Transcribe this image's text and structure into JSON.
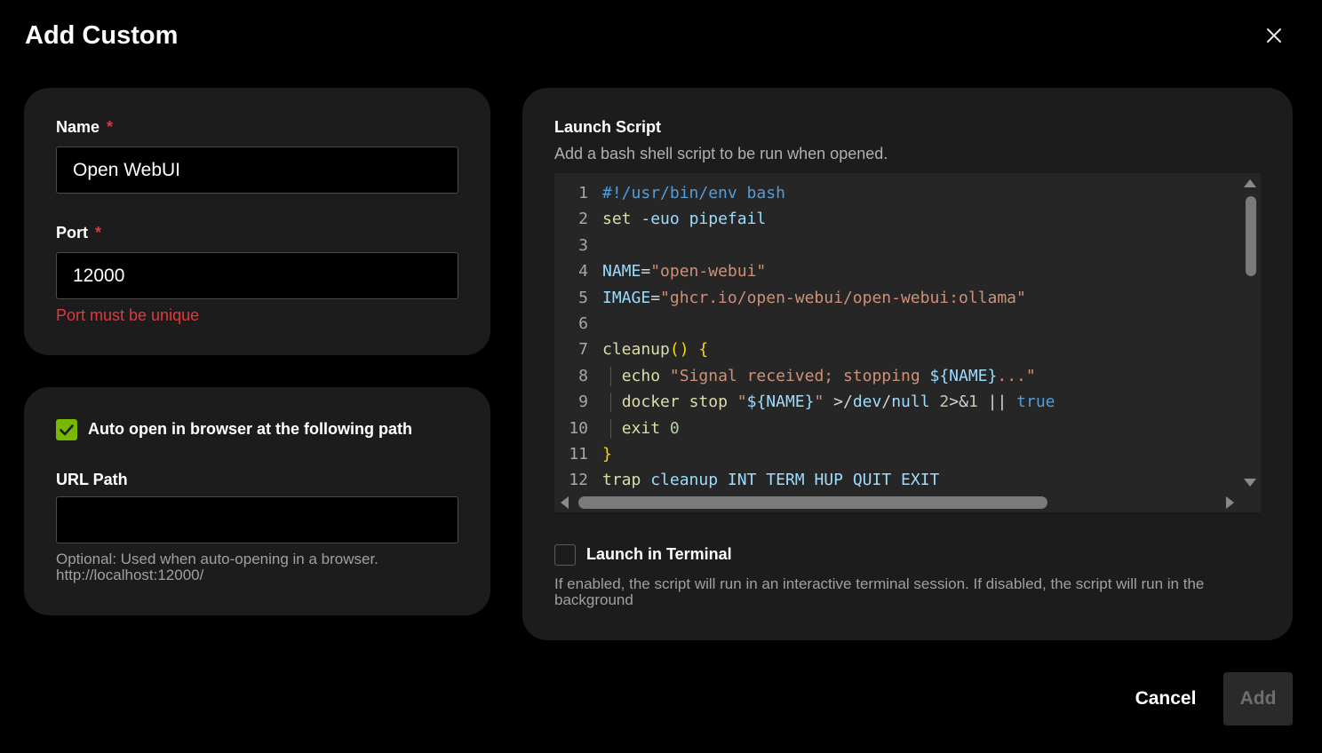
{
  "dialog": {
    "title": "Add Custom"
  },
  "name_field": {
    "label": "Name",
    "required_marker": "*",
    "value": "Open WebUI"
  },
  "port_field": {
    "label": "Port",
    "required_marker": "*",
    "value": "12000",
    "error": "Port must be unique"
  },
  "browser": {
    "auto_open_label": "Auto open in browser at the following path",
    "auto_open_checked": true,
    "url_label": "URL Path",
    "url_value": "",
    "help_line1": "Optional: Used when auto-opening in a browser.",
    "help_line2": "http://localhost:12000/"
  },
  "script": {
    "label": "Launch Script",
    "description": "Add a bash shell script to be run when opened.",
    "lines": [
      {
        "n": "1",
        "text": "#!/usr/bin/env bash"
      },
      {
        "n": "2",
        "text": "set -euo pipefail"
      },
      {
        "n": "3",
        "text": ""
      },
      {
        "n": "4",
        "text": "NAME=\"open-webui\""
      },
      {
        "n": "5",
        "text": "IMAGE=\"ghcr.io/open-webui/open-webui:ollama\""
      },
      {
        "n": "6",
        "text": ""
      },
      {
        "n": "7",
        "text": "cleanup() {"
      },
      {
        "n": "8",
        "text": "  echo \"Signal received; stopping ${NAME}...\""
      },
      {
        "n": "9",
        "text": "  docker stop \"${NAME}\" >/dev/null 2>&1 || true"
      },
      {
        "n": "10",
        "text": "  exit 0"
      },
      {
        "n": "11",
        "text": "}"
      },
      {
        "n": "12",
        "text": "trap cleanup INT TERM HUP QUIT EXIT"
      }
    ]
  },
  "terminal": {
    "label": "Launch in Terminal",
    "checked": false,
    "help": "If enabled, the script will run in an interactive terminal session. If disabled, the script will run in the background"
  },
  "actions": {
    "cancel": "Cancel",
    "add": "Add"
  },
  "colors": {
    "accent": "#76b900",
    "error": "#e0393e",
    "card": "#1c1c1c",
    "editor": "#262626"
  },
  "icons": {
    "close": "close-icon",
    "check": "checkmark-icon"
  }
}
